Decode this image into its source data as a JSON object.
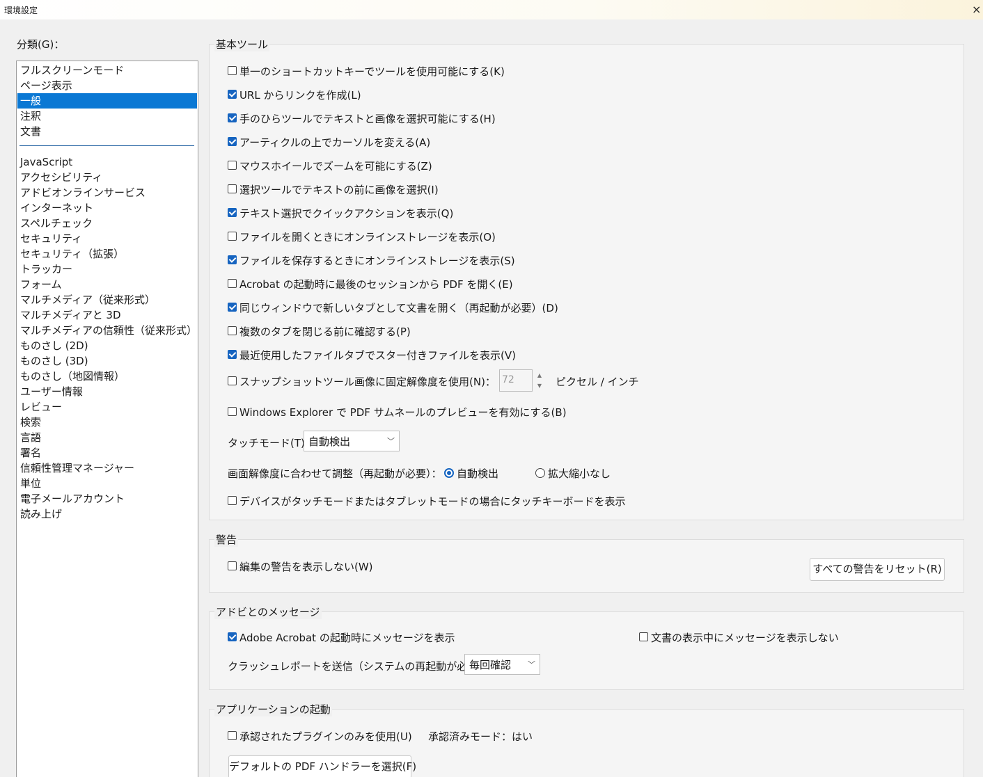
{
  "window": {
    "title": "環境設定",
    "close_label": "×"
  },
  "categories": {
    "label": "分類(G)：",
    "top_items": [
      "フルスクリーンモード",
      "ページ表示",
      "一般",
      "注釈",
      "文書"
    ],
    "selected": "一般",
    "other_items": [
      "JavaScript",
      "アクセシビリティ",
      "アドビオンラインサービス",
      "インターネット",
      "スペルチェック",
      "セキュリティ",
      "セキュリティ（拡張）",
      "トラッカー",
      "フォーム",
      "マルチメディア（従来形式）",
      "マルチメディアと 3D",
      "マルチメディアの信頼性（従来形式）",
      "ものさし (2D)",
      "ものさし (3D)",
      "ものさし（地図情報）",
      "ユーザー情報",
      "レビュー",
      "検索",
      "言語",
      "署名",
      "信頼性管理マネージャー",
      "単位",
      "電子メールアカウント",
      "読み上げ"
    ]
  },
  "basic_tools": {
    "title": "基本ツール",
    "options": [
      {
        "label": "単一のショートカットキーでツールを使用可能にする(K)",
        "checked": false
      },
      {
        "label": "URL からリンクを作成(L)",
        "checked": true
      },
      {
        "label": "手のひらツールでテキストと画像を選択可能にする(H)",
        "checked": true
      },
      {
        "label": "アーティクルの上でカーソルを変える(A)",
        "checked": true
      },
      {
        "label": "マウスホイールでズームを可能にする(Z)",
        "checked": false
      },
      {
        "label": "選択ツールでテキストの前に画像を選択(I)",
        "checked": false
      },
      {
        "label": "テキスト選択でクイックアクションを表示(Q)",
        "checked": true
      },
      {
        "label": "ファイルを開くときにオンラインストレージを表示(O)",
        "checked": false
      },
      {
        "label": "ファイルを保存するときにオンラインストレージを表示(S)",
        "checked": true
      },
      {
        "label": "Acrobat の起動時に最後のセッションから PDF を開く(E)",
        "checked": false
      },
      {
        "label": "同じウィンドウで新しいタブとして文書を開く（再起動が必要）(D)",
        "checked": true
      },
      {
        "label": "複数のタブを閉じる前に確認する(P)",
        "checked": false
      },
      {
        "label": "最近使用したファイルタブでスター付きファイルを表示(V)",
        "checked": true
      }
    ],
    "snapshot": {
      "label": "スナップショットツール画像に固定解像度を使用(N)：",
      "checked": false,
      "value": "72",
      "unit": "ピクセル / インチ",
      "spin_up": "▲",
      "spin_down": "▼"
    },
    "explorer_preview": {
      "label": "Windows Explorer で PDF サムネールのプレビューを有効にする(B)",
      "checked": false
    },
    "touch_mode": {
      "label": "タッチモード(T)：",
      "value": "自動検出",
      "chevron": "﹀"
    },
    "resolution": {
      "label": "画面解像度に合わせて調整（再起動が必要）：",
      "option_auto": "自動検出",
      "option_none": "拡大縮小なし",
      "selected": "自動検出"
    },
    "touch_keyboard": {
      "label": "デバイスがタッチモードまたはタブレットモードの場合にタッチキーボードを表示",
      "checked": false
    }
  },
  "warnings": {
    "title": "警告",
    "option": {
      "label": "編集の警告を表示しない(W)",
      "checked": false
    },
    "reset_button": "すべての警告をリセット(R)"
  },
  "adobe_messages": {
    "title": "アドビとのメッセージ",
    "show_on_launch": {
      "label": "Adobe Acrobat の起動時にメッセージを表示",
      "checked": true
    },
    "no_messages_viewing": {
      "label": "文書の表示中にメッセージを表示しない",
      "checked": false
    },
    "crash_report": {
      "label": "クラッシュレポートを送信（システムの再起動が必要）：",
      "value": "毎回確認",
      "chevron": "﹀"
    }
  },
  "app_startup": {
    "title": "アプリケーションの起動",
    "certified_plugins": {
      "label": "承認されたプラグインのみを使用(U)",
      "checked": false
    },
    "certified_mode_label": "承認済みモード：",
    "certified_mode_value": "はい",
    "default_handler_button": "デフォルトの PDF ハンドラーを選択(F)"
  }
}
